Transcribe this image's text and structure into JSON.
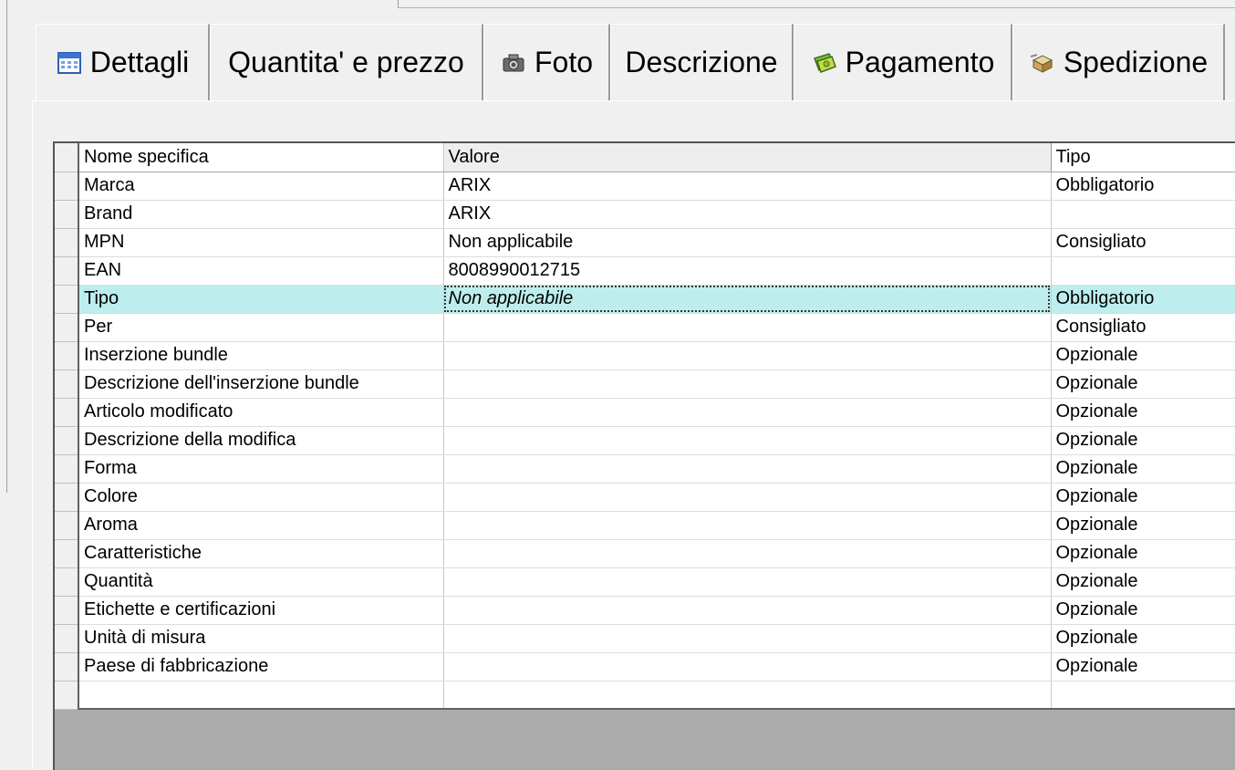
{
  "tabs": [
    {
      "label": "Dettagli",
      "icon": "calendar-icon"
    },
    {
      "label": "Quantita' e prezzo",
      "icon": null
    },
    {
      "label": "Foto",
      "icon": "camera-icon"
    },
    {
      "label": "Descrizione",
      "icon": null
    },
    {
      "label": "Pagamento",
      "icon": "money-icon"
    },
    {
      "label": "Spedizione",
      "icon": "shipping-icon"
    }
  ],
  "table": {
    "columns": [
      "Nome specifica",
      "Valore",
      "Tipo"
    ],
    "rows": [
      {
        "name": "Marca",
        "value": "ARIX",
        "type": "Obbligatorio"
      },
      {
        "name": "Brand",
        "value": "ARIX",
        "type": ""
      },
      {
        "name": "MPN",
        "value": "Non applicabile",
        "type": "Consigliato"
      },
      {
        "name": "EAN",
        "value": "8008990012715",
        "type": ""
      },
      {
        "name": "Tipo",
        "value": "Non applicabile",
        "type": "Obbligatorio"
      },
      {
        "name": "Per",
        "value": "",
        "type": "Consigliato"
      },
      {
        "name": "Inserzione bundle",
        "value": "",
        "type": "Opzionale"
      },
      {
        "name": "Descrizione dell'inserzione bundle",
        "value": "",
        "type": "Opzionale"
      },
      {
        "name": "Articolo modificato",
        "value": "",
        "type": "Opzionale"
      },
      {
        "name": "Descrizione della modifica",
        "value": "",
        "type": "Opzionale"
      },
      {
        "name": "Forma",
        "value": "",
        "type": "Opzionale"
      },
      {
        "name": "Colore",
        "value": "",
        "type": "Opzionale"
      },
      {
        "name": "Aroma",
        "value": "",
        "type": "Opzionale"
      },
      {
        "name": "Caratteristiche",
        "value": "",
        "type": "Opzionale"
      },
      {
        "name": "Quantità",
        "value": "",
        "type": "Opzionale"
      },
      {
        "name": "Etichette e certificazioni",
        "value": "",
        "type": "Opzionale"
      },
      {
        "name": "Unità di misura",
        "value": "",
        "type": "Opzionale"
      },
      {
        "name": "Paese di fabbricazione",
        "value": "",
        "type": "Opzionale"
      },
      {
        "name": "",
        "value": "",
        "type": ""
      }
    ],
    "selected_row": 4
  },
  "colors": {
    "selected_row": "#bdeeed",
    "empty_area": "#ababab"
  }
}
